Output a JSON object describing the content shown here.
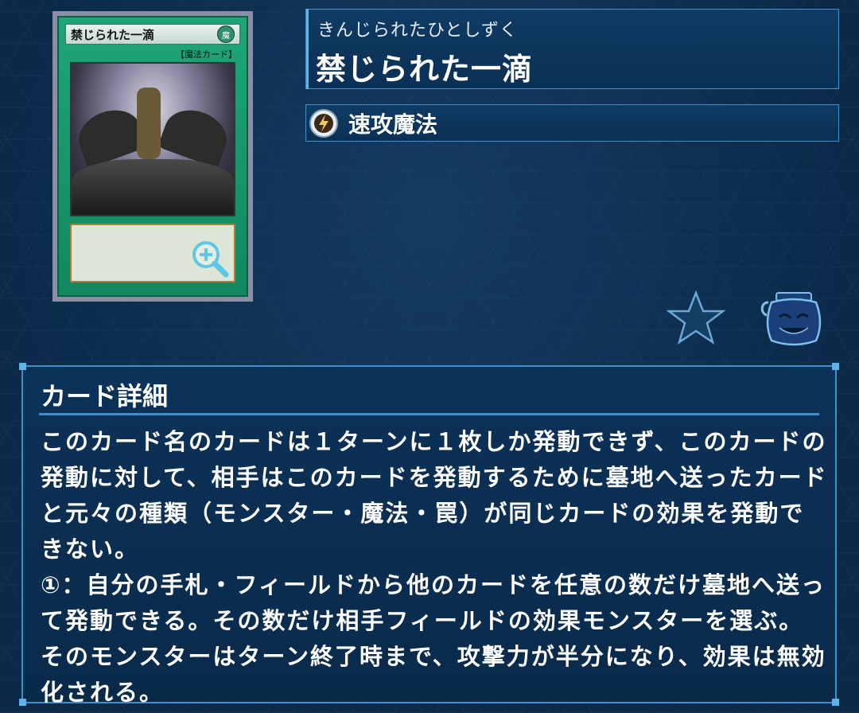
{
  "card": {
    "ruby": "きんじられたひとしずく",
    "name": "禁じられた一滴",
    "image_name_text": "禁じられた一滴",
    "image_type_label": "【魔法カード】",
    "spell_type": "速攻魔法"
  },
  "detail": {
    "title": "カード詳細",
    "text": "このカード名のカードは１ターンに１枚しか発動できず、このカードの発動に対して、相手はこのカードを発動するために墓地へ送ったカードと元々の種類（モンスター・魔法・罠）が同じカードの効果を発動できない。\n①：自分の手札・フィールドから他のカードを任意の数だけ墓地へ送って発動できる。その数だけ相手フィールドの効果モンスターを選ぶ。そのモンスターはターン終了時まで、攻撃力が半分になり、効果は無効化される。"
  },
  "icons": {
    "zoom": "zoom-in-icon",
    "spell_type": "quick-play-spell-icon",
    "favorite": "star-icon",
    "pot": "pot-of-greed-icon"
  },
  "colors": {
    "background": "#0b2a4a",
    "panel_border": "#3f8fc8",
    "spell_card": "#1fa57a"
  }
}
